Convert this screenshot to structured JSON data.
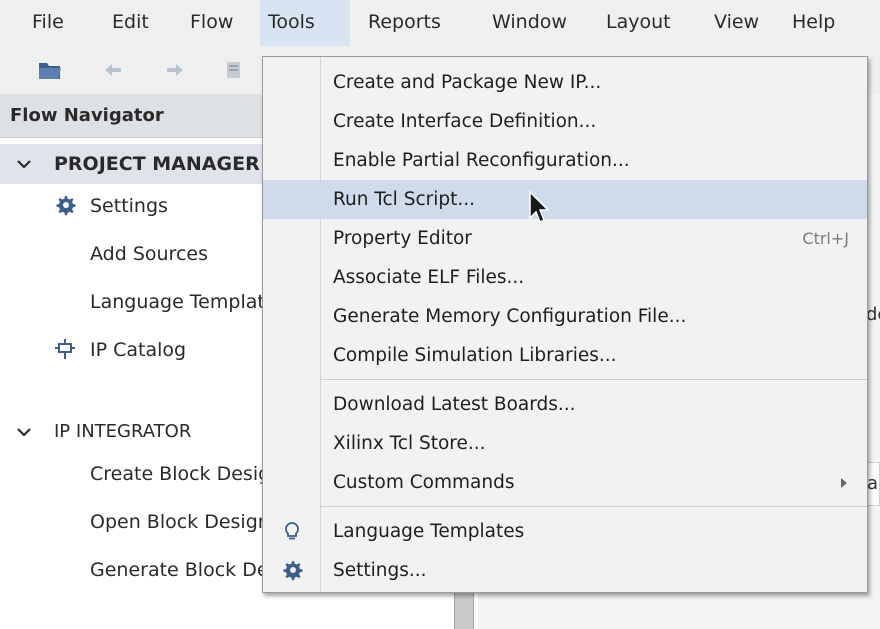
{
  "menubar": {
    "items": [
      {
        "label": "File"
      },
      {
        "label": "Edit"
      },
      {
        "label": "Flow"
      },
      {
        "label": "Tools"
      },
      {
        "label": "Reports"
      },
      {
        "label": "Window"
      },
      {
        "label": "Layout"
      },
      {
        "label": "View"
      },
      {
        "label": "Help"
      }
    ]
  },
  "toolbar": {
    "icons": [
      "open-project-icon",
      "undo-icon",
      "redo-icon",
      "copy-icon"
    ]
  },
  "flow_navigator": {
    "title": "Flow Navigator",
    "project_manager": {
      "label": "PROJECT MANAGER",
      "items": [
        {
          "label": "Settings",
          "icon": "gear-icon"
        },
        {
          "label": "Add Sources"
        },
        {
          "label": "Language Templates"
        },
        {
          "label": "IP Catalog",
          "icon": "ip-plug-icon"
        }
      ]
    },
    "ip_integrator": {
      "label": "IP INTEGRATOR",
      "items": [
        {
          "label": "Create Block Design"
        },
        {
          "label": "Open Block Design"
        },
        {
          "label": "Generate Block Design"
        }
      ]
    }
  },
  "right_pane": {
    "fragment_1": "de",
    "fragment_2": "a"
  },
  "tools_menu": {
    "items": [
      {
        "label": "Create and Package New IP..."
      },
      {
        "label": "Create Interface Definition..."
      },
      {
        "label": "Enable Partial Reconfiguration..."
      },
      {
        "label": "Run Tcl Script...",
        "highlighted": true
      },
      {
        "label": "Property Editor",
        "shortcut": "Ctrl+J"
      },
      {
        "label": "Associate ELF Files..."
      },
      {
        "label": "Generate Memory Configuration File..."
      },
      {
        "label": "Compile Simulation Libraries..."
      },
      {
        "label": "Download Latest Boards..."
      },
      {
        "label": "Xilinx Tcl Store..."
      },
      {
        "label": "Custom Commands",
        "submenu": true
      },
      {
        "label": "Language Templates",
        "icon": "lightbulb-icon"
      },
      {
        "label": "Settings...",
        "icon": "gear-icon"
      }
    ]
  },
  "colors": {
    "menu_active": "#d9e4f2",
    "highlight": "#cfdbea",
    "nav_header": "#dde1e6",
    "icon_blue": "#3b5e8c"
  }
}
